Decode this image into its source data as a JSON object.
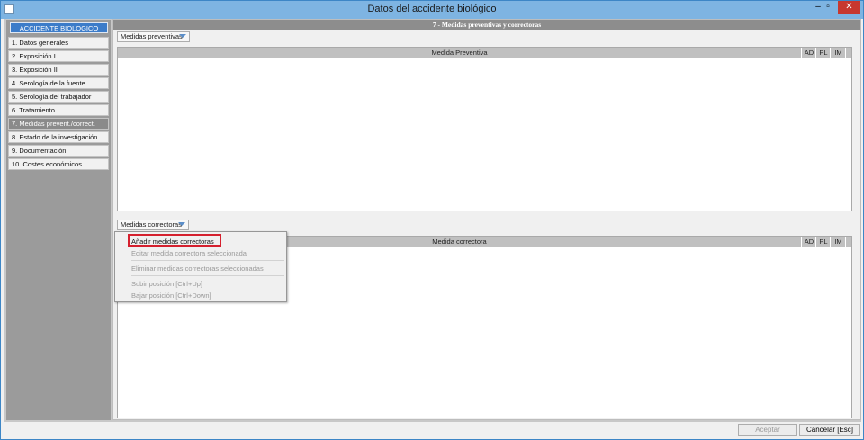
{
  "window": {
    "title": "Datos del accidente biológico",
    "minimize": "–",
    "maximize": "▫",
    "close": "✕"
  },
  "sidebar": {
    "header": "ACCIDENTE BIOLOGICO",
    "items": [
      {
        "label": "1. Datos generales"
      },
      {
        "label": "2. Exposición I"
      },
      {
        "label": "3. Exposición II"
      },
      {
        "label": "4. Serología de la fuente"
      },
      {
        "label": "5. Serología del trabajador"
      },
      {
        "label": "6. Tratamiento"
      },
      {
        "label": "7. Medidas prevent./correct."
      },
      {
        "label": "8. Estado de la investigación"
      },
      {
        "label": "9. Documentación"
      },
      {
        "label": "10. Costes económicos"
      }
    ]
  },
  "main": {
    "section_title": "7 - Medidas preventivas y correctoras",
    "preventive": {
      "dropdown": "Medidas preventivas",
      "columns": [
        "Medida Preventiva",
        "AD",
        "PL",
        "IM"
      ]
    },
    "corrective": {
      "dropdown": "Medidas correctoras",
      "columns": [
        "Medida correctora",
        "AD",
        "PL",
        "IM"
      ]
    },
    "context_menu": {
      "items": [
        {
          "label": "Añadir medidas correctoras"
        },
        {
          "label": "Editar medida correctora seleccionada"
        },
        {
          "label": "Eliminar medidas correctoras seleccionadas"
        },
        {
          "label": "Subir posición  [Ctrl+Up]"
        },
        {
          "label": "Bajar posición  [Ctrl+Down]"
        }
      ]
    }
  },
  "footer": {
    "accept": "Aceptar",
    "cancel": "Cancelar [Esc]"
  },
  "colors": {
    "titlebar": "#7eb4e2",
    "close": "#c7382f",
    "sidebar_header": "#3c7cc9",
    "highlight": "#d5202e"
  }
}
